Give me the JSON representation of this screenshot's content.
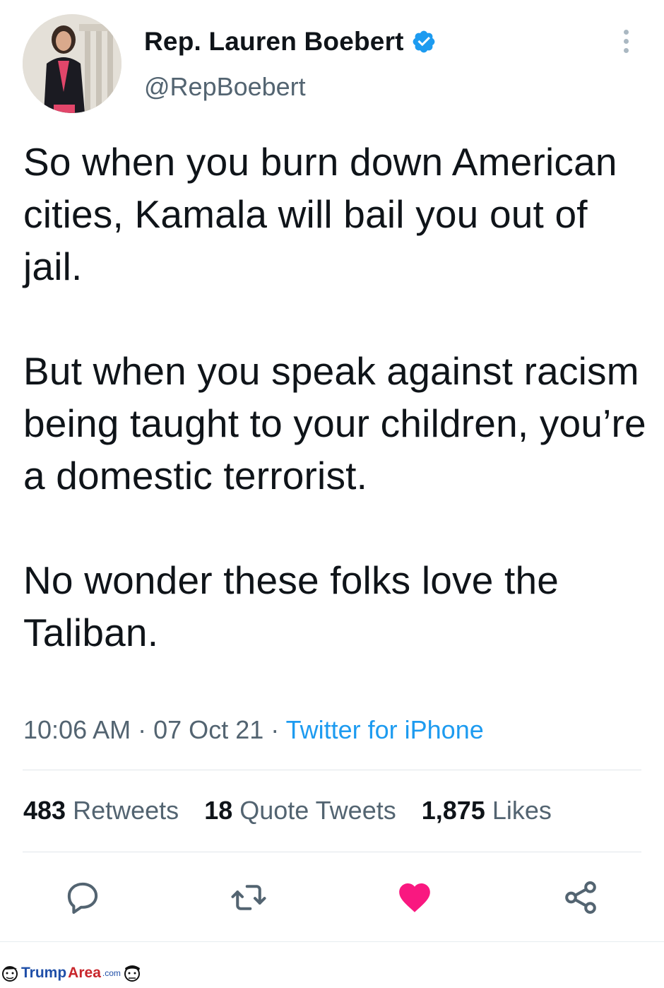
{
  "tweet": {
    "author": {
      "display_name": "Rep. Lauren Boebert",
      "handle": "@RepBoebert",
      "verified": true
    },
    "text_paragraphs": [
      "So when you burn down American cities, Kamala will bail you out of jail.",
      "But when you speak against racism being taught to your children, you’re a domestic terrorist.",
      "No wonder these folks love the Taliban."
    ],
    "time": "10:06 AM",
    "date": "07 Oct 21",
    "separator": "·",
    "source": "Twitter for iPhone",
    "stats": {
      "retweets_count": "483",
      "retweets_label": "Retweets",
      "quotes_count": "18",
      "quotes_label": "Quote Tweets",
      "likes_count": "1,875",
      "likes_label": "Likes"
    },
    "actions": [
      "reply-icon",
      "retweet-icon",
      "like-icon",
      "share-icon"
    ],
    "liked": true
  },
  "colors": {
    "text": "#0f1419",
    "secondary": "#536471",
    "link": "#1d9bf0",
    "like": "#f91880",
    "divider": "#e1e6ea"
  },
  "watermark": {
    "part1": "Trump",
    "part2": "Area",
    "suffix": ".com"
  }
}
